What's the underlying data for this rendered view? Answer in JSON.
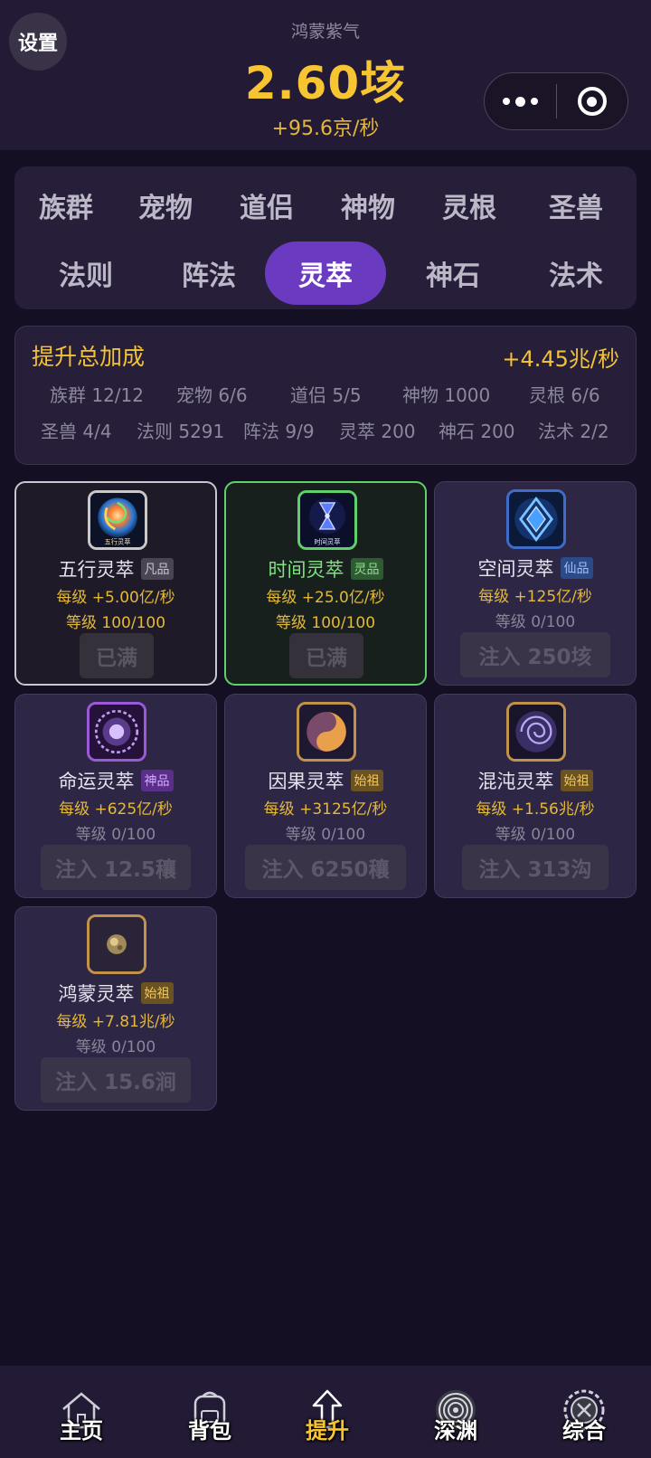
{
  "header": {
    "settings_label": "设置",
    "resource_name": "鸿蒙紫气",
    "resource_amount": "2.60垓",
    "resource_rate": "+95.6京/秒"
  },
  "capsule": {
    "more_icon": "more-dots-icon",
    "close_icon": "target-circle-icon"
  },
  "tabs": [
    {
      "label": "族群",
      "active": false
    },
    {
      "label": "宠物",
      "active": false
    },
    {
      "label": "道侣",
      "active": false
    },
    {
      "label": "神物",
      "active": false
    },
    {
      "label": "灵根",
      "active": false
    },
    {
      "label": "圣兽",
      "active": false
    },
    {
      "label": "法则",
      "active": false
    },
    {
      "label": "阵法",
      "active": false
    },
    {
      "label": "灵萃",
      "active": true
    },
    {
      "label": "神石",
      "active": false
    },
    {
      "label": "法术",
      "active": false
    }
  ],
  "bonus": {
    "title": "提升总加成",
    "total": "+4.45兆/秒",
    "items": [
      "族群 12/12",
      "宠物 6/6",
      "道侣 5/5",
      "神物 1000",
      "灵根 6/6",
      "圣兽 4/4",
      "法则 5291",
      "阵法 9/9",
      "灵萃 200",
      "神石 200",
      "法术 2/2"
    ]
  },
  "cards": [
    {
      "name": "五行灵萃",
      "grade": "凡品",
      "grade_color": "#4a4552",
      "grade_text": "#c8c3d0",
      "per": "每级 +5.00亿/秒",
      "level": "等级 100/100",
      "action": "已满",
      "icon": "five-elements-icon",
      "icon_caption": "五行灵萃"
    },
    {
      "name": "时间灵萃",
      "grade": "灵品",
      "grade_color": "#2f5a34",
      "grade_text": "#8ee08e",
      "per": "每级 +25.0亿/秒",
      "level": "等级 100/100",
      "action": "已满",
      "icon": "hourglass-icon",
      "icon_caption": "时间灵萃"
    },
    {
      "name": "空间灵萃",
      "grade": "仙品",
      "grade_color": "#2c4a86",
      "grade_text": "#9ec2ff",
      "per": "每级 +125亿/秒",
      "level": "等级 0/100",
      "action": "注入 250垓",
      "icon": "space-crystal-icon"
    },
    {
      "name": "命运灵萃",
      "grade": "神品",
      "grade_color": "#5a2f8a",
      "grade_text": "#d6aaff",
      "per": "每级 +625亿/秒",
      "level": "等级 0/100",
      "action": "注入 12.5穰",
      "icon": "fate-wheel-icon"
    },
    {
      "name": "因果灵萃",
      "grade": "始祖",
      "grade_color": "#6a5222",
      "grade_text": "#f1c862",
      "per": "每级 +3125亿/秒",
      "level": "等级 0/100",
      "action": "注入 6250穰",
      "icon": "karma-swirl-icon"
    },
    {
      "name": "混沌灵萃",
      "grade": "始祖",
      "grade_color": "#6a5222",
      "grade_text": "#f1c862",
      "per": "每级 +1.56兆/秒",
      "level": "等级 0/100",
      "action": "注入 313沟",
      "icon": "chaos-vortex-icon"
    },
    {
      "name": "鸿蒙灵萃",
      "grade": "始祖",
      "grade_color": "#6a5222",
      "grade_text": "#f1c862",
      "per": "每级 +7.81兆/秒",
      "level": "等级 0/100",
      "action": "注入 15.6涧",
      "icon": "primordial-orb-icon"
    }
  ],
  "nav": [
    {
      "label": "主页",
      "icon": "house-icon",
      "active": false
    },
    {
      "label": "背包",
      "icon": "backpack-icon",
      "active": false
    },
    {
      "label": "提升",
      "icon": "arrow-up-icon",
      "active": true
    },
    {
      "label": "深渊",
      "icon": "abyss-vortex-icon",
      "active": false
    },
    {
      "label": "综合",
      "icon": "gear-wheel-icon",
      "active": false
    }
  ]
}
